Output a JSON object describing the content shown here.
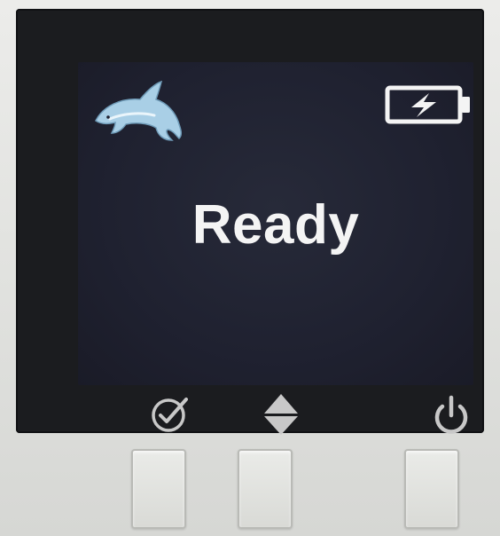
{
  "screen": {
    "status_text": "Ready"
  },
  "icons": {
    "logo": "dolphin-icon",
    "battery": "battery-charging-icon",
    "confirm": "checkmark-circle-icon",
    "navigate": "up-down-arrows-icon",
    "power": "power-icon"
  },
  "colors": {
    "lcd_background": "#202232",
    "text": "#f4f4f4",
    "dolphin": "#a9cfe6",
    "bezel": "#1b1c1f",
    "hardware_icons": "#c8c8c8"
  }
}
